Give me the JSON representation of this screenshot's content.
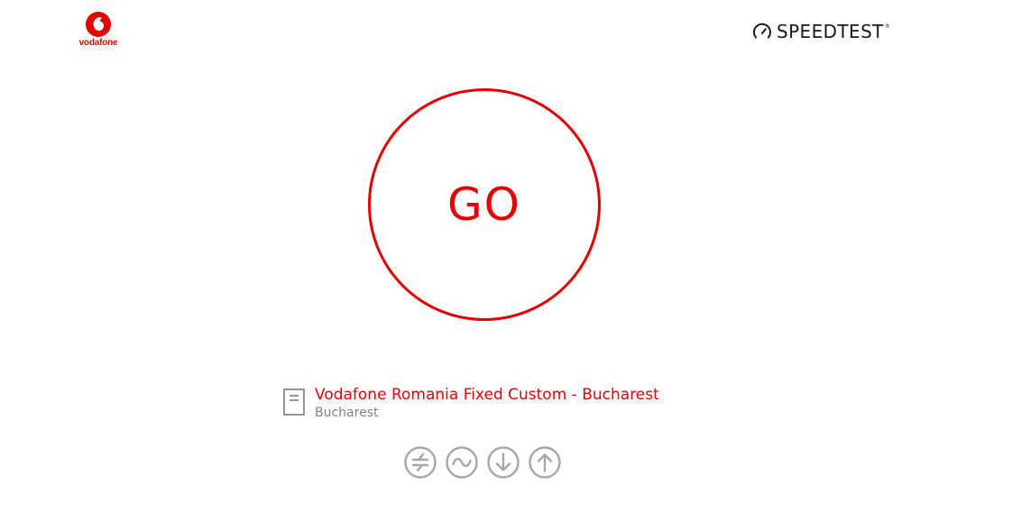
{
  "brand": {
    "wordmark": "vodafone",
    "color": "#e60000"
  },
  "header": {
    "speedtest_label": "SPEEDTEST",
    "speedtest_icon": "gauge-icon",
    "trademark": "®"
  },
  "main": {
    "go_label": "GO",
    "accent_color": "#e60000"
  },
  "server": {
    "icon": "server-icon",
    "name": "Vodafone Romania Fixed Custom - Bucharest",
    "location": "Bucharest"
  },
  "metrics": [
    {
      "icon": "ping-icon",
      "name": "ping"
    },
    {
      "icon": "jitter-icon",
      "name": "jitter"
    },
    {
      "icon": "download-icon",
      "name": "download"
    },
    {
      "icon": "upload-icon",
      "name": "upload"
    }
  ],
  "colors": {
    "accent": "#e60000",
    "muted_icon": "#a6a6a6",
    "text_muted": "#808080"
  }
}
